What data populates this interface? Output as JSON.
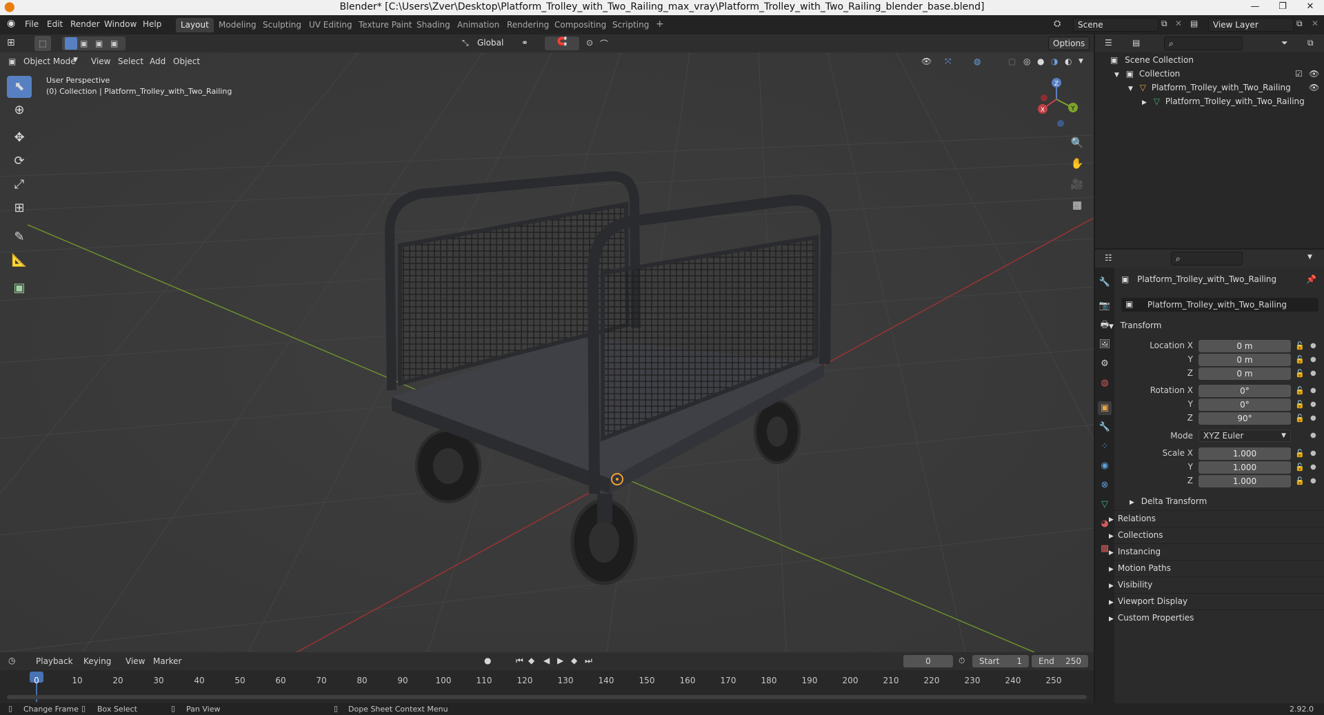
{
  "window": {
    "title": "Blender* [C:\\Users\\Zver\\Desktop\\Platform_Trolley_with_Two_Railing_max_vray\\Platform_Trolley_with_Two_Railing_blender_base.blend]"
  },
  "menubar": {
    "items": [
      "File",
      "Edit",
      "Render",
      "Window",
      "Help"
    ]
  },
  "workspaces": {
    "tabs": [
      "Layout",
      "Modeling",
      "Sculpting",
      "UV Editing",
      "Texture Paint",
      "Shading",
      "Animation",
      "Rendering",
      "Compositing",
      "Scripting"
    ],
    "active": "Layout",
    "add_label": "+"
  },
  "scene": {
    "name": "Scene",
    "view_layer": "View Layer"
  },
  "toolbar": {
    "orientation": "Global",
    "options_label": "Options"
  },
  "viewport": {
    "mode": "Object Mode",
    "menus": [
      "View",
      "Select",
      "Add",
      "Object"
    ],
    "perspective_label": "User Perspective",
    "collection_label": "(0) Collection | Platform_Trolley_with_Two_Railing",
    "gizmo_axes": {
      "x": "X",
      "y": "Y",
      "z": "Z"
    }
  },
  "outliner": {
    "root": "Scene Collection",
    "collection": "Collection",
    "object": "Platform_Trolley_with_Two_Railing",
    "mesh": "Platform_Trolley_with_Two_Railing"
  },
  "properties": {
    "object_name": "Platform_Trolley_with_Two_Railing",
    "object_field": "Platform_Trolley_with_Two_Railing",
    "transform_header": "Transform",
    "location": {
      "label_x": "Location X",
      "label_y": "Y",
      "label_z": "Z",
      "x": "0 m",
      "y": "0 m",
      "z": "0 m"
    },
    "rotation": {
      "label_x": "Rotation X",
      "label_y": "Y",
      "label_z": "Z",
      "x": "0°",
      "y": "0°",
      "z": "90°"
    },
    "mode_label": "Mode",
    "mode_value": "XYZ Euler",
    "scale": {
      "label_x": "Scale X",
      "label_y": "Y",
      "label_z": "Z",
      "x": "1.000",
      "y": "1.000",
      "z": "1.000"
    },
    "delta_transform": "Delta Transform",
    "panels": [
      "Relations",
      "Collections",
      "Instancing",
      "Motion Paths",
      "Visibility",
      "Viewport Display",
      "Custom Properties"
    ]
  },
  "timeline": {
    "menus": [
      "Playback",
      "Keying",
      "View",
      "Marker"
    ],
    "current_frame": "0",
    "start_label": "Start",
    "start": "1",
    "end_label": "End",
    "end": "250",
    "ticks": [
      "0",
      "10",
      "20",
      "30",
      "40",
      "50",
      "60",
      "70",
      "80",
      "90",
      "100",
      "110",
      "120",
      "130",
      "140",
      "150",
      "160",
      "170",
      "180",
      "190",
      "200",
      "210",
      "220",
      "230",
      "240",
      "250"
    ]
  },
  "statusbar": {
    "change_frame": "Change Frame",
    "box_select": "Box Select",
    "pan_view": "Pan View",
    "context_menu": "Dope Sheet Context Menu",
    "version": "2.92.0"
  }
}
